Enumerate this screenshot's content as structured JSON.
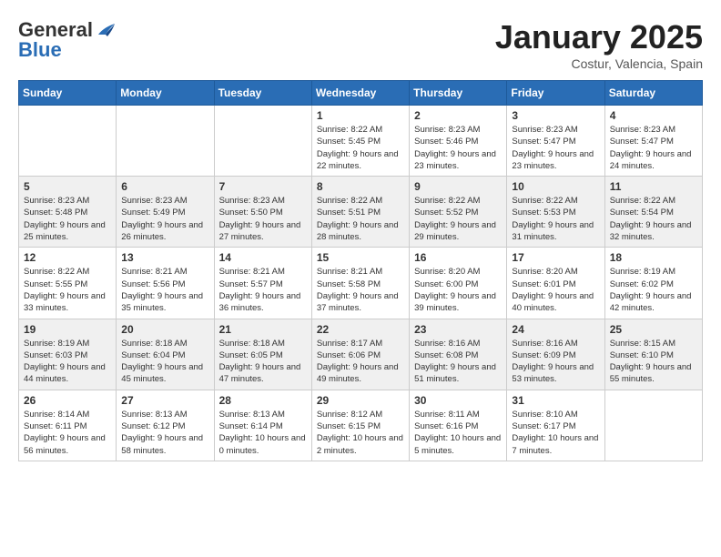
{
  "header": {
    "logo_general": "General",
    "logo_blue": "Blue",
    "month_title": "January 2025",
    "location": "Costur, Valencia, Spain"
  },
  "days_of_week": [
    "Sunday",
    "Monday",
    "Tuesday",
    "Wednesday",
    "Thursday",
    "Friday",
    "Saturday"
  ],
  "weeks": [
    {
      "shaded": false,
      "days": [
        {
          "number": "",
          "info": ""
        },
        {
          "number": "",
          "info": ""
        },
        {
          "number": "",
          "info": ""
        },
        {
          "number": "1",
          "sunrise": "Sunrise: 8:22 AM",
          "sunset": "Sunset: 5:45 PM",
          "daylight": "Daylight: 9 hours and 22 minutes."
        },
        {
          "number": "2",
          "sunrise": "Sunrise: 8:23 AM",
          "sunset": "Sunset: 5:46 PM",
          "daylight": "Daylight: 9 hours and 23 minutes."
        },
        {
          "number": "3",
          "sunrise": "Sunrise: 8:23 AM",
          "sunset": "Sunset: 5:47 PM",
          "daylight": "Daylight: 9 hours and 23 minutes."
        },
        {
          "number": "4",
          "sunrise": "Sunrise: 8:23 AM",
          "sunset": "Sunset: 5:47 PM",
          "daylight": "Daylight: 9 hours and 24 minutes."
        }
      ]
    },
    {
      "shaded": true,
      "days": [
        {
          "number": "5",
          "sunrise": "Sunrise: 8:23 AM",
          "sunset": "Sunset: 5:48 PM",
          "daylight": "Daylight: 9 hours and 25 minutes."
        },
        {
          "number": "6",
          "sunrise": "Sunrise: 8:23 AM",
          "sunset": "Sunset: 5:49 PM",
          "daylight": "Daylight: 9 hours and 26 minutes."
        },
        {
          "number": "7",
          "sunrise": "Sunrise: 8:23 AM",
          "sunset": "Sunset: 5:50 PM",
          "daylight": "Daylight: 9 hours and 27 minutes."
        },
        {
          "number": "8",
          "sunrise": "Sunrise: 8:22 AM",
          "sunset": "Sunset: 5:51 PM",
          "daylight": "Daylight: 9 hours and 28 minutes."
        },
        {
          "number": "9",
          "sunrise": "Sunrise: 8:22 AM",
          "sunset": "Sunset: 5:52 PM",
          "daylight": "Daylight: 9 hours and 29 minutes."
        },
        {
          "number": "10",
          "sunrise": "Sunrise: 8:22 AM",
          "sunset": "Sunset: 5:53 PM",
          "daylight": "Daylight: 9 hours and 31 minutes."
        },
        {
          "number": "11",
          "sunrise": "Sunrise: 8:22 AM",
          "sunset": "Sunset: 5:54 PM",
          "daylight": "Daylight: 9 hours and 32 minutes."
        }
      ]
    },
    {
      "shaded": false,
      "days": [
        {
          "number": "12",
          "sunrise": "Sunrise: 8:22 AM",
          "sunset": "Sunset: 5:55 PM",
          "daylight": "Daylight: 9 hours and 33 minutes."
        },
        {
          "number": "13",
          "sunrise": "Sunrise: 8:21 AM",
          "sunset": "Sunset: 5:56 PM",
          "daylight": "Daylight: 9 hours and 35 minutes."
        },
        {
          "number": "14",
          "sunrise": "Sunrise: 8:21 AM",
          "sunset": "Sunset: 5:57 PM",
          "daylight": "Daylight: 9 hours and 36 minutes."
        },
        {
          "number": "15",
          "sunrise": "Sunrise: 8:21 AM",
          "sunset": "Sunset: 5:58 PM",
          "daylight": "Daylight: 9 hours and 37 minutes."
        },
        {
          "number": "16",
          "sunrise": "Sunrise: 8:20 AM",
          "sunset": "Sunset: 6:00 PM",
          "daylight": "Daylight: 9 hours and 39 minutes."
        },
        {
          "number": "17",
          "sunrise": "Sunrise: 8:20 AM",
          "sunset": "Sunset: 6:01 PM",
          "daylight": "Daylight: 9 hours and 40 minutes."
        },
        {
          "number": "18",
          "sunrise": "Sunrise: 8:19 AM",
          "sunset": "Sunset: 6:02 PM",
          "daylight": "Daylight: 9 hours and 42 minutes."
        }
      ]
    },
    {
      "shaded": true,
      "days": [
        {
          "number": "19",
          "sunrise": "Sunrise: 8:19 AM",
          "sunset": "Sunset: 6:03 PM",
          "daylight": "Daylight: 9 hours and 44 minutes."
        },
        {
          "number": "20",
          "sunrise": "Sunrise: 8:18 AM",
          "sunset": "Sunset: 6:04 PM",
          "daylight": "Daylight: 9 hours and 45 minutes."
        },
        {
          "number": "21",
          "sunrise": "Sunrise: 8:18 AM",
          "sunset": "Sunset: 6:05 PM",
          "daylight": "Daylight: 9 hours and 47 minutes."
        },
        {
          "number": "22",
          "sunrise": "Sunrise: 8:17 AM",
          "sunset": "Sunset: 6:06 PM",
          "daylight": "Daylight: 9 hours and 49 minutes."
        },
        {
          "number": "23",
          "sunrise": "Sunrise: 8:16 AM",
          "sunset": "Sunset: 6:08 PM",
          "daylight": "Daylight: 9 hours and 51 minutes."
        },
        {
          "number": "24",
          "sunrise": "Sunrise: 8:16 AM",
          "sunset": "Sunset: 6:09 PM",
          "daylight": "Daylight: 9 hours and 53 minutes."
        },
        {
          "number": "25",
          "sunrise": "Sunrise: 8:15 AM",
          "sunset": "Sunset: 6:10 PM",
          "daylight": "Daylight: 9 hours and 55 minutes."
        }
      ]
    },
    {
      "shaded": false,
      "days": [
        {
          "number": "26",
          "sunrise": "Sunrise: 8:14 AM",
          "sunset": "Sunset: 6:11 PM",
          "daylight": "Daylight: 9 hours and 56 minutes."
        },
        {
          "number": "27",
          "sunrise": "Sunrise: 8:13 AM",
          "sunset": "Sunset: 6:12 PM",
          "daylight": "Daylight: 9 hours and 58 minutes."
        },
        {
          "number": "28",
          "sunrise": "Sunrise: 8:13 AM",
          "sunset": "Sunset: 6:14 PM",
          "daylight": "Daylight: 10 hours and 0 minutes."
        },
        {
          "number": "29",
          "sunrise": "Sunrise: 8:12 AM",
          "sunset": "Sunset: 6:15 PM",
          "daylight": "Daylight: 10 hours and 2 minutes."
        },
        {
          "number": "30",
          "sunrise": "Sunrise: 8:11 AM",
          "sunset": "Sunset: 6:16 PM",
          "daylight": "Daylight: 10 hours and 5 minutes."
        },
        {
          "number": "31",
          "sunrise": "Sunrise: 8:10 AM",
          "sunset": "Sunset: 6:17 PM",
          "daylight": "Daylight: 10 hours and 7 minutes."
        },
        {
          "number": "",
          "info": ""
        }
      ]
    }
  ]
}
